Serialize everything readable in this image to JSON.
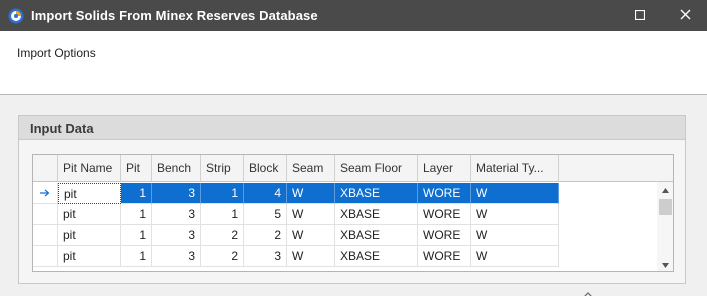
{
  "window": {
    "title": "Import Solids From Minex Reserves Database"
  },
  "options": {
    "label": "Import Options"
  },
  "input_group": {
    "title": "Input Data"
  },
  "grid": {
    "columns": [
      "Pit Name",
      "Pit",
      "Bench",
      "Strip",
      "Block",
      "Seam",
      "Seam Floor",
      "Layer",
      "Material Ty..."
    ],
    "rows": [
      [
        "pit",
        "1",
        "3",
        "1",
        "4",
        "W",
        "XBASE",
        "WORE",
        "W"
      ],
      [
        "pit",
        "1",
        "3",
        "1",
        "5",
        "W",
        "XBASE",
        "WORE",
        "W"
      ],
      [
        "pit",
        "1",
        "3",
        "2",
        "2",
        "W",
        "XBASE",
        "WORE",
        "W"
      ],
      [
        "pit",
        "1",
        "3",
        "2",
        "3",
        "W",
        "XBASE",
        "WORE",
        "W"
      ]
    ],
    "selected_row": 0
  },
  "colors": {
    "titlebar": "#4a4a4a",
    "selection": "#0e6fd0",
    "row_indicator": "#1a6fd6"
  }
}
